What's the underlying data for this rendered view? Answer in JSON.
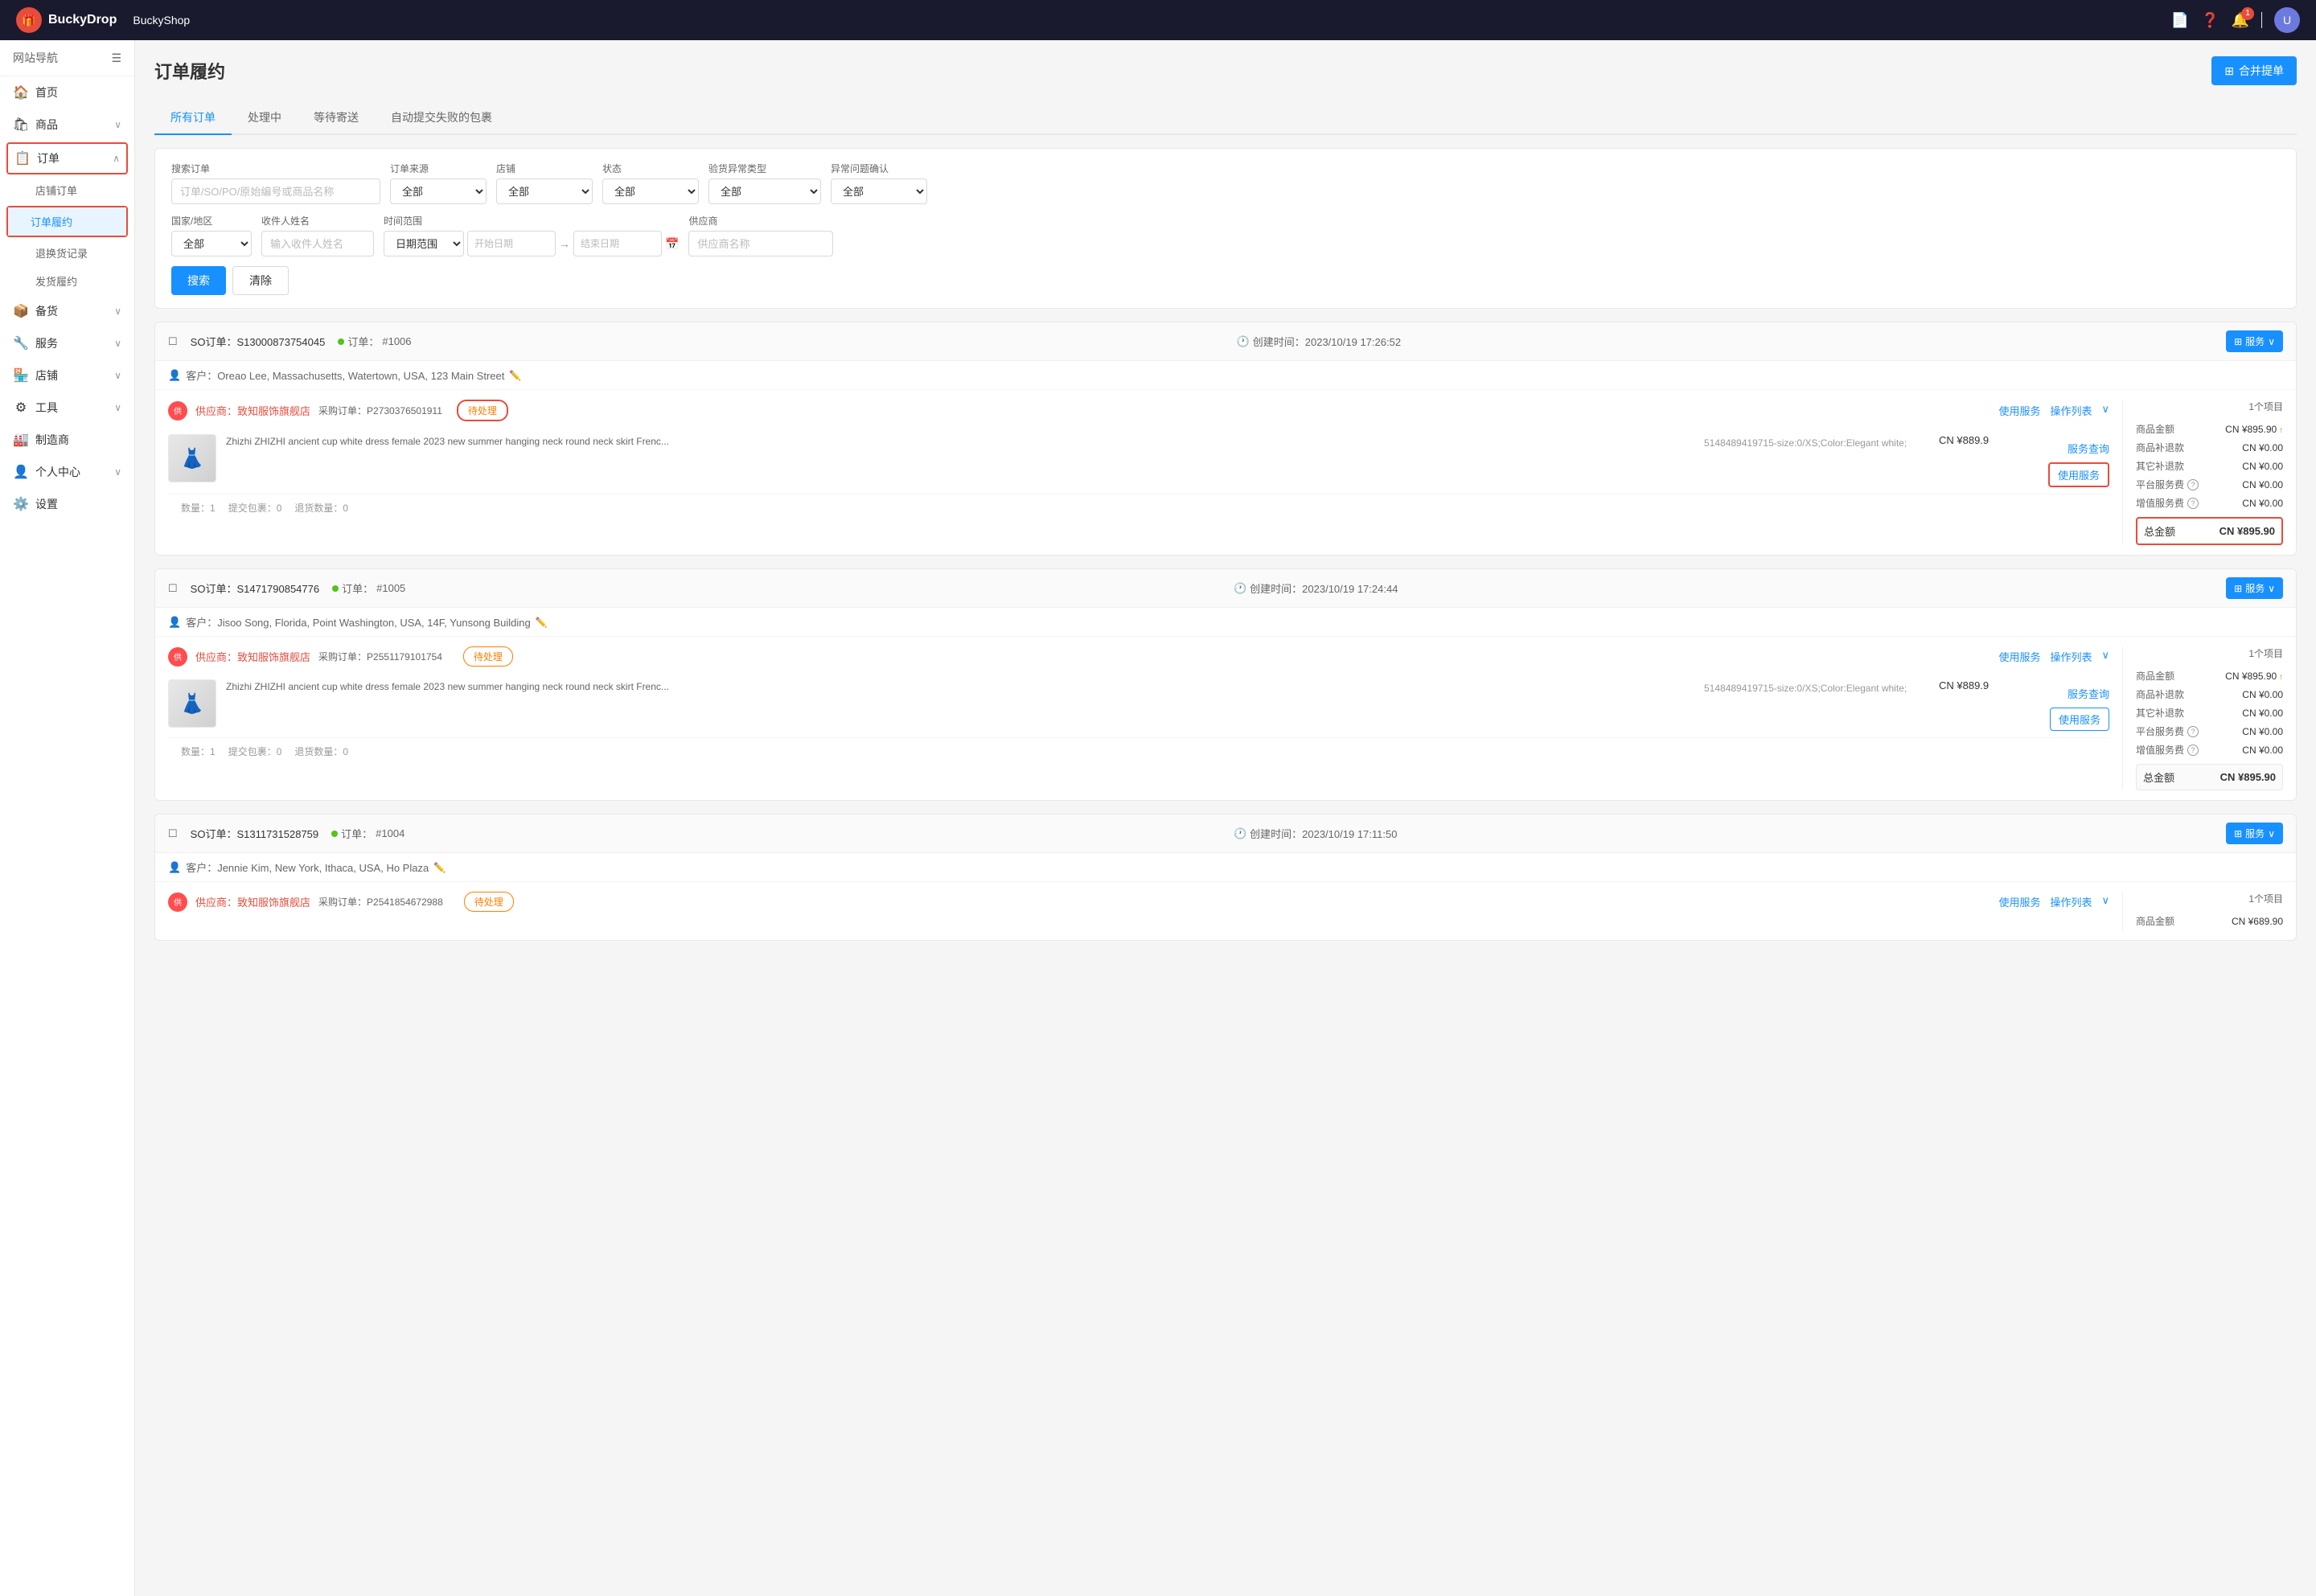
{
  "header": {
    "brand": "BuckyDrop",
    "shop": "BuckyShop",
    "logo_text": "🎁",
    "avatar_text": "U"
  },
  "sidebar": {
    "nav_label": "网站导航",
    "items": [
      {
        "id": "home",
        "label": "首页",
        "icon": "🏠",
        "active": false
      },
      {
        "id": "products",
        "label": "商品",
        "icon": "🛍",
        "active": false,
        "has_arrow": true
      },
      {
        "id": "orders",
        "label": "订单",
        "icon": "📋",
        "active": true,
        "has_arrow": true,
        "boxed": true
      },
      {
        "id": "store-orders",
        "label": "店铺订单",
        "sub": true,
        "active": false
      },
      {
        "id": "order-fulfillment",
        "label": "订单履约",
        "sub": true,
        "active": true,
        "boxed": true
      },
      {
        "id": "return-records",
        "label": "退换货记录",
        "sub": true,
        "active": false
      },
      {
        "id": "shipping",
        "label": "发货履约",
        "sub": true,
        "active": false
      },
      {
        "id": "inventory",
        "label": "备货",
        "icon": "📦",
        "active": false,
        "has_arrow": true
      },
      {
        "id": "service",
        "label": "服务",
        "icon": "🔧",
        "active": false,
        "has_arrow": true
      },
      {
        "id": "store",
        "label": "店铺",
        "icon": "🏪",
        "active": false,
        "has_arrow": true
      },
      {
        "id": "tools",
        "label": "工具",
        "icon": "⚙",
        "active": false,
        "has_arrow": true
      },
      {
        "id": "manufacturer",
        "label": "制造商",
        "icon": "🏭",
        "active": false
      },
      {
        "id": "profile",
        "label": "个人中心",
        "icon": "👤",
        "active": false,
        "has_arrow": true
      },
      {
        "id": "settings",
        "label": "设置",
        "icon": "⚙️",
        "active": false
      }
    ]
  },
  "page": {
    "title": "订单履约",
    "merge_btn": "合并提单"
  },
  "tabs": [
    {
      "id": "all",
      "label": "所有订单",
      "active": true
    },
    {
      "id": "processing",
      "label": "处理中",
      "active": false
    },
    {
      "id": "pending-ship",
      "label": "等待寄送",
      "active": false
    },
    {
      "id": "auto-fail",
      "label": "自动提交失败的包裹",
      "active": false
    }
  ],
  "search": {
    "so_label": "搜索订单",
    "so_placeholder": "订单/SO/PO/原始编号或商品名称",
    "source_label": "订单来源",
    "source_default": "全部",
    "store_label": "店铺",
    "store_default": "全部",
    "status_label": "状态",
    "status_default": "全部",
    "inspection_label": "验货异常类型",
    "inspection_default": "全部",
    "exception_label": "异常问题确认",
    "exception_default": "全部",
    "country_label": "国家/地区",
    "country_default": "全部",
    "receiver_label": "收件人姓名",
    "receiver_placeholder": "输入收件人姓名",
    "date_label": "时间范围",
    "date_placeholder": "日期范围",
    "date_start": "开始日期",
    "date_end": "结束日期",
    "supplier_label": "供应商",
    "supplier_placeholder": "供应商名称",
    "search_btn": "搜索",
    "clear_btn": "清除"
  },
  "orders": [
    {
      "id": "order1",
      "so": "SO订单：S13000873754045",
      "order_num": "#1006",
      "created": "创建时间：2023/10/19 17:26:52",
      "customer": "客户：Oreao Lee, Massachusetts, Watertown, USA, 123 Main Street",
      "supplier": "供应商：致知服饰旗舰店",
      "purchase_order": "采购订单：P2730376501911",
      "status": "待处理",
      "status_highlighted": true,
      "items_count": "1个项目",
      "product_name": "Zhizhi ZHIZHI ancient cup white dress female 2023 new summer hanging neck round neck skirt Frenc...",
      "product_sku": "5148489419715-size:0/XS;Color:Elegant white;",
      "product_price": "CN ¥889.9",
      "quantity": "数量：1",
      "submitted_packages": "提交包裹：0",
      "returned_qty": "退货数量：0",
      "summary": {
        "product_amount_label": "商品金额",
        "product_amount": "CN ¥895.90",
        "product_amount_has_arrow": true,
        "product_refund_label": "商品补退款",
        "product_refund": "CN ¥0.00",
        "other_refund_label": "其它补退款",
        "other_refund": "CN ¥0.00",
        "platform_fee_label": "平台服务费",
        "platform_fee": "CN ¥0.00",
        "vat_label": "增值服务费",
        "vat": "CN ¥0.00",
        "total_label": "总金额",
        "total": "CN ¥895.90",
        "total_highlighted": true
      }
    },
    {
      "id": "order2",
      "so": "SO订单：S1471790854776",
      "order_num": "#1005",
      "created": "创建时间：2023/10/19 17:24:44",
      "customer": "客户：Jisoo Song, Florida, Point Washington, USA, 14F, Yunsong Building",
      "supplier": "供应商：致知服饰旗舰店",
      "purchase_order": "采购订单：P2551179101754",
      "status": "待处理",
      "status_highlighted": false,
      "items_count": "1个项目",
      "product_name": "Zhizhi ZHIZHI ancient cup white dress female 2023 new summer hanging neck round neck skirt Frenc...",
      "product_sku": "5148489419715-size:0/XS;Color:Elegant white;",
      "product_price": "CN ¥889.9",
      "quantity": "数量：1",
      "submitted_packages": "提交包裹：0",
      "returned_qty": "退货数量：0",
      "summary": {
        "product_amount_label": "商品金额",
        "product_amount": "CN ¥895.90",
        "product_amount_has_arrow": true,
        "product_refund_label": "商品补退款",
        "product_refund": "CN ¥0.00",
        "other_refund_label": "其它补退款",
        "other_refund": "CN ¥0.00",
        "platform_fee_label": "平台服务费",
        "platform_fee": "CN ¥0.00",
        "vat_label": "增值服务费",
        "vat": "CN ¥0.00",
        "total_label": "总金额",
        "total": "CN ¥895.90",
        "total_highlighted": false
      }
    },
    {
      "id": "order3",
      "so": "SO订单：S1311731528759",
      "order_num": "#1004",
      "created": "创建时间：2023/10/19 17:11:50",
      "customer": "客户：Jennie Kim, New York, Ithaca, USA, Ho Plaza",
      "supplier": "供应商：致知服饰旗舰店",
      "purchase_order": "采购订单：P2541854672988",
      "status": "待处理",
      "status_highlighted": false,
      "items_count": "1个项目",
      "product_name": "",
      "product_sku": "",
      "product_price": "",
      "quantity": "",
      "submitted_packages": "",
      "returned_qty": "",
      "summary": {
        "product_amount_label": "商品金额",
        "product_amount": "CN ¥689.90",
        "product_amount_has_arrow": false,
        "product_refund_label": "",
        "product_refund": "",
        "other_refund_label": "",
        "other_refund": "",
        "platform_fee_label": "",
        "platform_fee": "",
        "vat_label": "",
        "vat": "",
        "total_label": "",
        "total": "",
        "total_highlighted": false
      }
    }
  ],
  "labels": {
    "service_btn": "服务",
    "service_query": "服务查询",
    "use_service": "使用服务",
    "operation_list": "操作列表",
    "customer_prefix": "客户：",
    "supplier_prefix": "供应商："
  }
}
